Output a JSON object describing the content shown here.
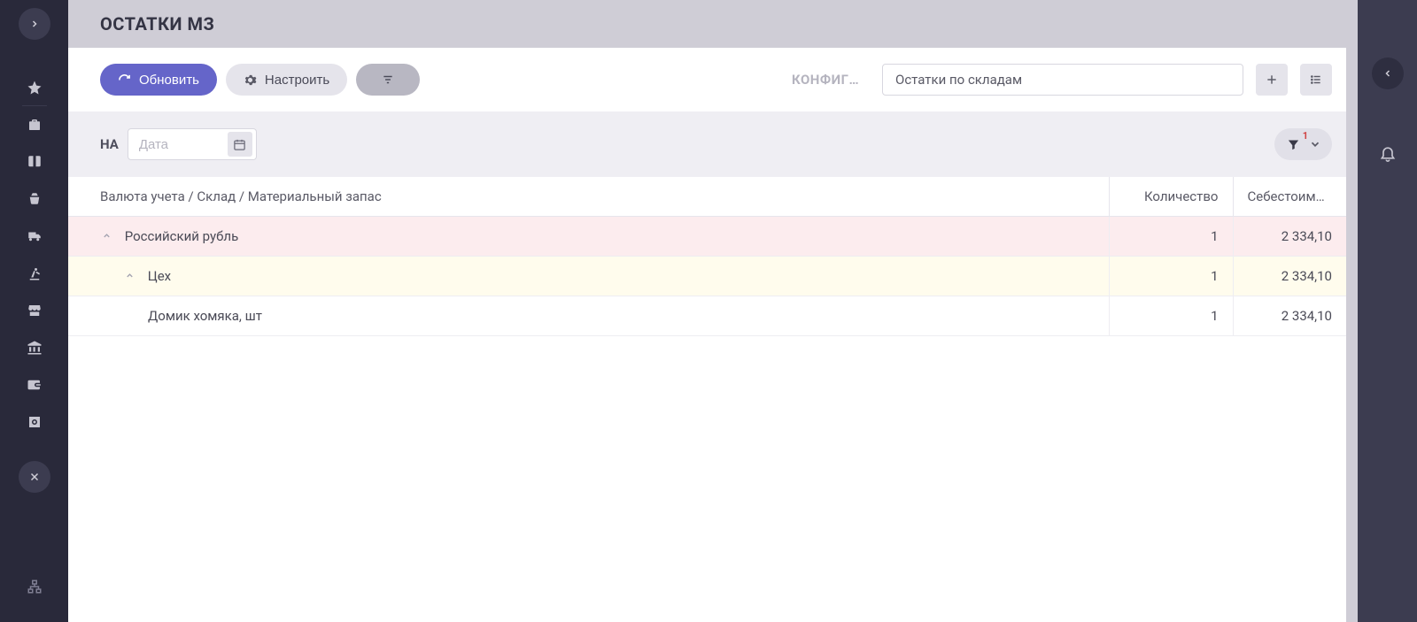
{
  "page": {
    "title": "ОСТАТКИ МЗ"
  },
  "toolbar": {
    "refresh_label": "Обновить",
    "configure_label": "Настроить",
    "config_section_label": "КОНФИГУРАЦИЯ",
    "config_selected": "Остатки по складам"
  },
  "filter": {
    "on_label": "НА",
    "date_placeholder": "Дата",
    "active_count": "1"
  },
  "table": {
    "col_group": "Валюта учета / Склад / Материальный запас",
    "col_qty": "Количество",
    "col_cost": "Себестоимо…",
    "rows": [
      {
        "level": "currency",
        "label": "Российский рубль",
        "qty": "1",
        "cost": "2 334,10"
      },
      {
        "level": "warehouse",
        "label": "Цех",
        "qty": "1",
        "cost": "2 334,10"
      },
      {
        "level": "item",
        "label": "Домик хомяка, шт",
        "qty": "1",
        "cost": "2 334,10"
      }
    ]
  },
  "icons": {
    "chevron_right": "›",
    "chevron_left": "‹"
  }
}
